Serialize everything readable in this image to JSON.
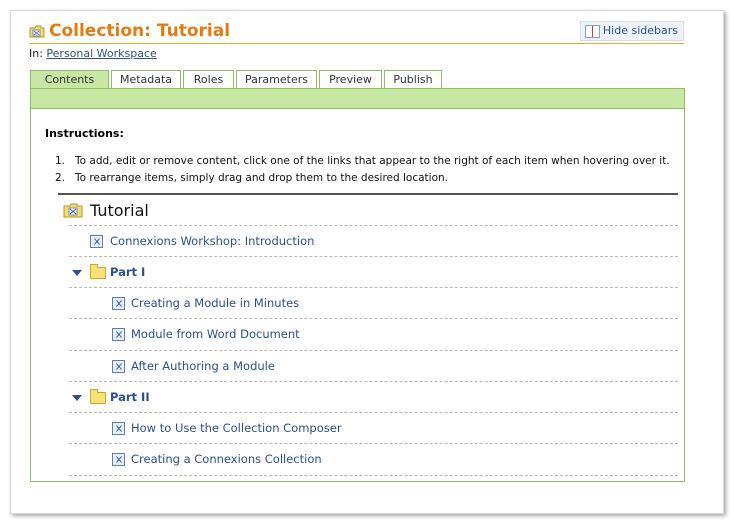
{
  "header": {
    "title": "Collection: Tutorial",
    "hide_sidebars": "Hide sidebars",
    "in_prefix": "In:",
    "in_link": "Personal Workspace"
  },
  "tabs": [
    {
      "label": "Contents",
      "active": true
    },
    {
      "label": "Metadata"
    },
    {
      "label": "Roles"
    },
    {
      "label": "Parameters"
    },
    {
      "label": "Preview"
    },
    {
      "label": "Publish"
    }
  ],
  "instructions": {
    "heading": "Instructions:",
    "items": [
      {
        "num": "1.",
        "text": "To add, edit or remove content, click one of the links that appear to the right of each item when hovering over it."
      },
      {
        "num": "2.",
        "text": "To rearrange items, simply drag and drop them to the desired location."
      }
    ]
  },
  "tree": {
    "root": "Tutorial",
    "items": [
      {
        "type": "module",
        "label": "Connexions Workshop: Introduction"
      },
      {
        "type": "folder",
        "label": "Part I"
      },
      {
        "type": "module",
        "label": "Creating a Module in Minutes"
      },
      {
        "type": "module",
        "label": "Module from Word Document"
      },
      {
        "type": "module",
        "label": "After Authoring a Module"
      },
      {
        "type": "folder",
        "label": "Part II"
      },
      {
        "type": "module",
        "label": "How to Use the Collection Composer"
      },
      {
        "type": "module",
        "label": "Creating a Connexions Collection"
      }
    ]
  },
  "colors": {
    "title": "#e47a12",
    "link": "#2a5090",
    "tab_active": "#c8e6a4",
    "tab_border": "#8dc060"
  }
}
